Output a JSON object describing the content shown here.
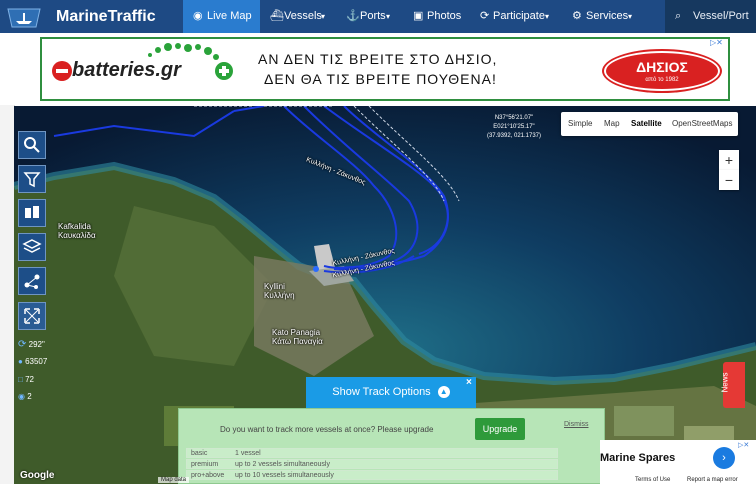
{
  "nav": {
    "brand": "MarineTraffic",
    "items": [
      {
        "label": "Live Map",
        "icon": "globe-icon",
        "active": true
      },
      {
        "label": "Vessels",
        "icon": "ship-icon",
        "caret": "▾"
      },
      {
        "label": "Ports",
        "icon": "anchor-icon",
        "caret": "▾"
      },
      {
        "label": "Photos",
        "icon": "camera-icon"
      },
      {
        "label": "Participate",
        "icon": "refresh-icon",
        "caret": "▾"
      },
      {
        "label": "Services",
        "icon": "gear-icon",
        "caret": "▾"
      }
    ],
    "search_placeholder": "Vessel/Port"
  },
  "ad": {
    "logo_text": "batteries.gr",
    "line1": "ΑΝ ΔΕΝ ΤΙΣ ΒΡΕΙΤΕ ΣΤΟ ΔΗΣΙΟ,",
    "line2": "ΔΕΝ ΘΑ ΤΙΣ ΒΡΕΙΤΕ ΠΟΥΘΕΝΑ!",
    "badge_text": "ΔΗΣΙΟΣ",
    "badge_sub": "από το 1982"
  },
  "map": {
    "coords": {
      "lat": "N37°56'21.07\"",
      "lon": "E021°10'25.17\"",
      "decimal": "(37.9392, 021.1737)"
    },
    "map_types": [
      "Simple",
      "Map",
      "Satellite",
      "OpenStreetMaps"
    ],
    "zoom_in": "+",
    "zoom_out": "−",
    "labels": [
      {
        "name": "Kafkalida",
        "sub": "Καυκαλίδα"
      },
      {
        "name": "Kyllini",
        "sub": "Κυλλήνη"
      },
      {
        "name": "Kato Panagia",
        "sub": "Κάτω Παναγία"
      }
    ],
    "route_labels": [
      "Κυλλήνη - Ζάκυνθος",
      "Κυλλήνη - Ζάκυνθος",
      "Κυλλήνη - Ζάκυνθος"
    ],
    "stats": [
      {
        "icon": "refresh-icon",
        "value": "292\""
      },
      {
        "icon": "info-icon",
        "value": "63507"
      },
      {
        "icon": "square-icon",
        "value": "72"
      },
      {
        "icon": "eye-icon",
        "value": "2"
      }
    ],
    "google": "Google",
    "attr": [
      "Map data",
      "Terms of Use",
      "Report a map error"
    ]
  },
  "track": {
    "button": "Show Track Options",
    "close": "×",
    "question": "Do you want to track more vessels at once? Please upgrade",
    "upgrade": "Upgrade",
    "dismiss": "Dismiss",
    "plans": [
      {
        "tier": "basic",
        "desc": "1 vessel"
      },
      {
        "tier": "premium",
        "desc": "up to 2 vessels simultaneously"
      },
      {
        "tier": "pro+above",
        "desc": "up to 10 vessels simultaneously"
      }
    ]
  },
  "news_tab": "News",
  "ad2": {
    "text": "Marine Spares",
    "arrow": "›"
  },
  "colors": {
    "nav": "#1e4a84",
    "nav_active": "#2a7ccf",
    "route": "#1a3ae0",
    "track_btn": "#1a9be6",
    "upgrade": "#2e9a3a",
    "news": "#e53935"
  }
}
